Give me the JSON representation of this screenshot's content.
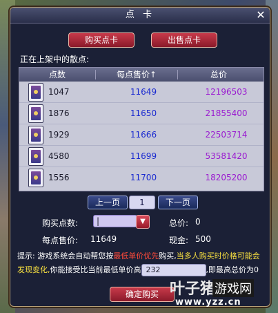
{
  "window": {
    "title": "点 卡",
    "close_symbol": "✕"
  },
  "tabs": {
    "buy_label": "购买点卡",
    "sell_label": "出售点卡"
  },
  "section": {
    "listing_label": "正在上架中的散点:"
  },
  "table": {
    "headers": [
      "点数",
      "每点售价↑",
      "总价"
    ],
    "rows": [
      {
        "points": "1047",
        "unit_price": "11649",
        "total": "12196503"
      },
      {
        "points": "1876",
        "unit_price": "11650",
        "total": "21855400"
      },
      {
        "points": "1929",
        "unit_price": "11666",
        "total": "22503714"
      },
      {
        "points": "4580",
        "unit_price": "11699",
        "total": "53581420"
      },
      {
        "points": "1556",
        "unit_price": "11700",
        "total": "18205200"
      }
    ]
  },
  "pager": {
    "prev_label": "上一页",
    "page": "1",
    "next_label": "下一页"
  },
  "purchase": {
    "buy_points_label": "购买点数:",
    "buy_points_value": "|",
    "total_label": "总价:",
    "total_value": "0",
    "unit_price_label": "每点售价:",
    "unit_price_value": "11649",
    "cash_label": "现金:",
    "cash_value": "500"
  },
  "tips": {
    "prefix": "提示: ",
    "text1": "游戏系统会自动帮您按",
    "highlight_red": "最低单价优先",
    "text2": "购买,",
    "highlight_yellow": "当多人购买时价格可能会发现变化,",
    "text3": "你能接受比当前最低单价高",
    "max_value": "232",
    "text4": ",即最高总价为",
    "max_total": "0"
  },
  "confirm": {
    "label": "确定购买"
  },
  "watermark": {
    "brand": "叶子猪",
    "tag": "游戏网",
    "url": "www.yzz.cn"
  },
  "colors": {
    "unit_price": "#1a2ad0",
    "total": "#9a1ad0",
    "accent_red": "#c83a4a"
  }
}
